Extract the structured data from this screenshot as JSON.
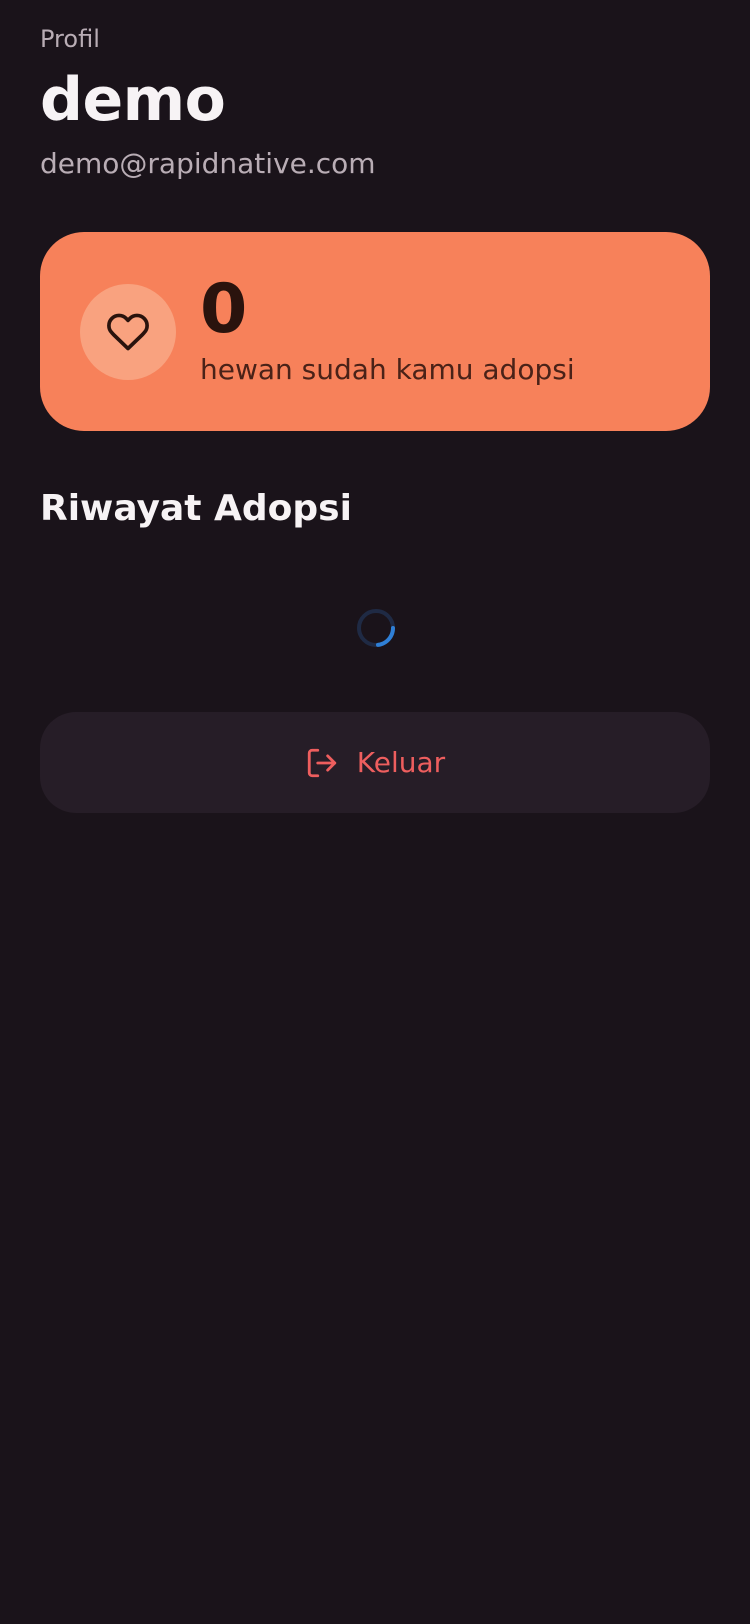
{
  "header": {
    "label": "Profil",
    "name": "demo",
    "email": "demo@rapidnative.com"
  },
  "stat": {
    "icon": "heart-icon",
    "value": "0",
    "caption": "hewan sudah kamu adopsi"
  },
  "history": {
    "title": "Riwayat Adopsi",
    "loading_indicator": "spinner"
  },
  "logout": {
    "icon": "logout-icon",
    "label": "Keluar"
  },
  "colors": {
    "background": "#1a131a",
    "card_accent": "#f7815a",
    "danger": "#ee5e5e",
    "spinner": "#2f7fd6"
  }
}
